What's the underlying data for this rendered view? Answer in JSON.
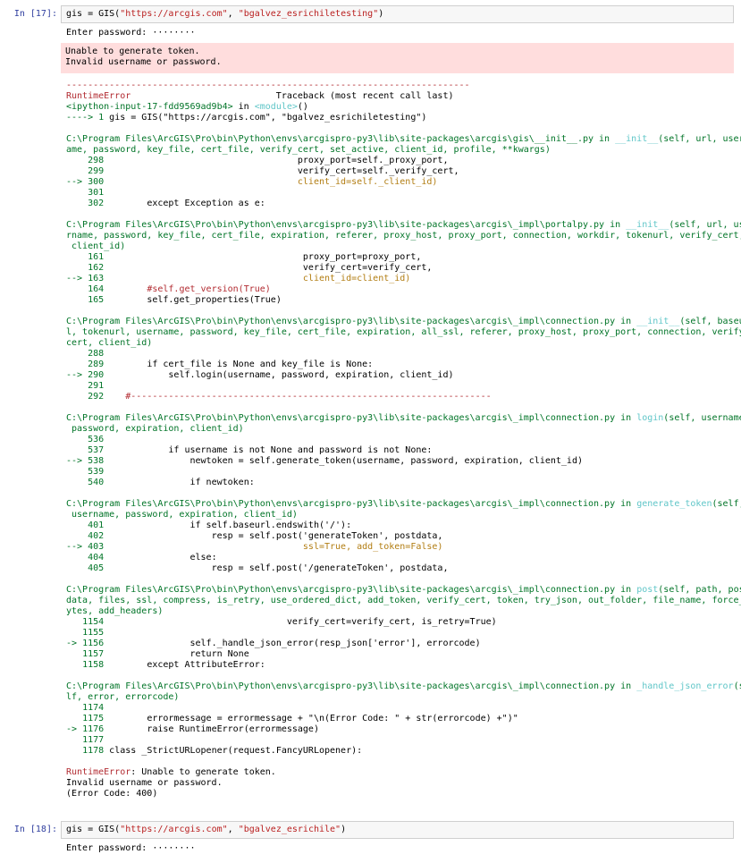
{
  "cell17": {
    "prompt": "In [17]:",
    "code_pre": "gis = GIS(",
    "code_s1": "\"https://arcgis.com\"",
    "code_mid": ", ",
    "code_s2": "\"bgalvez_esrichiletesting\"",
    "code_post": ")",
    "password_prompt": "Enter password: ········",
    "stderr": "Unable to generate token.\nInvalid username or password."
  },
  "traceback": {
    "dashes": "---------------------------------------------------------------------------",
    "err_name": "RuntimeError",
    "tb_header": "                           Traceback (most recent call last)",
    "input_ref": "<ipython-input-17-fdd9569ad9b4>",
    "in_word": " in ",
    "module": "<module>",
    "module_paren": "()",
    "line1_arrow": "----> 1 ",
    "line1_code": "gis = GIS(\"https://arcgis.com\", \"bgalvez_esrichiletesting\")",
    "frames": [
      {
        "path_lines": [
          "C:\\Program Files\\ArcGIS\\Pro\\bin\\Python\\envs\\arcgispro-py3\\lib\\site-packages\\arcgis\\gis\\__init__.py in ",
          "ame, password, key_file, cert_file, verify_cert, set_active, client_id, profile, **kwargs)"
        ],
        "func": "__init__",
        "func_rest": "(self, url, usern",
        "lines": [
          {
            "arrow": "    ",
            "num": "298",
            "code": "                                    proxy_port=self._proxy_port,",
            "hl": false
          },
          {
            "arrow": "    ",
            "num": "299",
            "code": "                                    verify_cert=self._verify_cert,",
            "hl": false
          },
          {
            "arrow": "--> ",
            "num": "300",
            "code": "                                    client_id=self._client_id)",
            "hl": true
          },
          {
            "arrow": "    ",
            "num": "301",
            "code": "",
            "hl": false
          },
          {
            "arrow": "    ",
            "num": "302",
            "code": "        except Exception as e:",
            "hl": false
          }
        ]
      },
      {
        "path_lines": [
          "C:\\Program Files\\ArcGIS\\Pro\\bin\\Python\\envs\\arcgispro-py3\\lib\\site-packages\\arcgis\\_impl\\portalpy.py in ",
          "rname, password, key_file, cert_file, expiration, referer, proxy_host, proxy_port, connection, workdir, tokenurl, verify_cert,",
          " client_id)"
        ],
        "func": "__init__",
        "func_rest": "(self, url, use",
        "lines": [
          {
            "arrow": "    ",
            "num": "161",
            "code": "                                     proxy_port=proxy_port,",
            "hl": false
          },
          {
            "arrow": "    ",
            "num": "162",
            "code": "                                     verify_cert=verify_cert,",
            "hl": false
          },
          {
            "arrow": "--> ",
            "num": "163",
            "code": "                                     client_id=client_id)",
            "hl": true
          },
          {
            "arrow": "    ",
            "num": "164",
            "code": "        #self.get_version(True)",
            "hl": false,
            "comment": true
          },
          {
            "arrow": "    ",
            "num": "165",
            "code": "        self.get_properties(True)",
            "hl": false
          }
        ]
      },
      {
        "path_lines": [
          "C:\\Program Files\\ArcGIS\\Pro\\bin\\Python\\envs\\arcgispro-py3\\lib\\site-packages\\arcgis\\_impl\\connection.py in ",
          "l, tokenurl, username, password, key_file, cert_file, expiration, all_ssl, referer, proxy_host, proxy_port, connection, verify_",
          "cert, client_id)"
        ],
        "func": "__init__",
        "func_rest": "(self, baseur",
        "lines": [
          {
            "arrow": "    ",
            "num": "288",
            "code": "",
            "hl": false
          },
          {
            "arrow": "    ",
            "num": "289",
            "code": "        if cert_file is None and key_file is None:",
            "hl": false
          },
          {
            "arrow": "--> ",
            "num": "290",
            "code": "            self.login(username, password, expiration, client_id)",
            "hl": false
          },
          {
            "arrow": "    ",
            "num": "291",
            "code": "",
            "hl": false
          },
          {
            "arrow": "    ",
            "num": "292",
            "code": "    #-------------------------------------------------------------------",
            "hl": false,
            "comment": true
          }
        ]
      },
      {
        "path_lines": [
          "C:\\Program Files\\ArcGIS\\Pro\\bin\\Python\\envs\\arcgispro-py3\\lib\\site-packages\\arcgis\\_impl\\connection.py in ",
          " password, expiration, client_id)"
        ],
        "func": "login",
        "func_rest": "(self, username,",
        "lines": [
          {
            "arrow": "    ",
            "num": "536",
            "code": "",
            "hl": false
          },
          {
            "arrow": "    ",
            "num": "537",
            "code": "            if username is not None and password is not None:",
            "hl": false
          },
          {
            "arrow": "--> ",
            "num": "538",
            "code": "                newtoken = self.generate_token(username, password, expiration, client_id)",
            "hl": false
          },
          {
            "arrow": "    ",
            "num": "539",
            "code": "",
            "hl": false
          },
          {
            "arrow": "    ",
            "num": "540",
            "code": "                if newtoken:",
            "hl": false
          }
        ]
      },
      {
        "path_lines": [
          "C:\\Program Files\\ArcGIS\\Pro\\bin\\Python\\envs\\arcgispro-py3\\lib\\site-packages\\arcgis\\_impl\\connection.py in ",
          " username, password, expiration, client_id)"
        ],
        "func": "generate_token",
        "func_rest": "(self,",
        "lines": [
          {
            "arrow": "    ",
            "num": "401",
            "code": "                if self.baseurl.endswith('/'):",
            "hl": false
          },
          {
            "arrow": "    ",
            "num": "402",
            "code": "                    resp = self.post('generateToken', postdata,",
            "hl": false
          },
          {
            "arrow": "--> ",
            "num": "403",
            "code": "                                     ssl=True, add_token=False)",
            "hl": true
          },
          {
            "arrow": "    ",
            "num": "404",
            "code": "                else:",
            "hl": false
          },
          {
            "arrow": "    ",
            "num": "405",
            "code": "                    resp = self.post('/generateToken', postdata,",
            "hl": false
          }
        ]
      },
      {
        "path_lines": [
          "C:\\Program Files\\ArcGIS\\Pro\\bin\\Python\\envs\\arcgispro-py3\\lib\\site-packages\\arcgis\\_impl\\connection.py in ",
          "data, files, ssl, compress, is_retry, use_ordered_dict, add_token, verify_cert, token, try_json, out_folder, file_name, force_b",
          "ytes, add_headers)"
        ],
        "func": "post",
        "func_rest": "(self, path, post",
        "lines": [
          {
            "arrow": "   ",
            "num": "1154",
            "code": "                                  verify_cert=verify_cert, is_retry=True)",
            "hl": false
          },
          {
            "arrow": "   ",
            "num": "1155",
            "code": "",
            "hl": false
          },
          {
            "arrow": "-> ",
            "num": "1156",
            "code": "                self._handle_json_error(resp_json['error'], errorcode)",
            "hl": false
          },
          {
            "arrow": "   ",
            "num": "1157",
            "code": "                return None",
            "hl": false
          },
          {
            "arrow": "   ",
            "num": "1158",
            "code": "        except AttributeError:",
            "hl": false
          }
        ]
      },
      {
        "path_lines": [
          "C:\\Program Files\\ArcGIS\\Pro\\bin\\Python\\envs\\arcgispro-py3\\lib\\site-packages\\arcgis\\_impl\\connection.py in ",
          "lf, error, errorcode)"
        ],
        "func": "_handle_json_error",
        "func_rest": "(se",
        "lines": [
          {
            "arrow": "   ",
            "num": "1174",
            "code": "",
            "hl": false
          },
          {
            "arrow": "   ",
            "num": "1175",
            "code": "        errormessage = errormessage + \"\\n(Error Code: \" + str(errorcode) +\")\"",
            "hl": false
          },
          {
            "arrow": "-> ",
            "num": "1176",
            "code": "        raise RuntimeError(errormessage)",
            "hl": false
          },
          {
            "arrow": "   ",
            "num": "1177",
            "code": "",
            "hl": false
          },
          {
            "arrow": "   ",
            "num": "1178",
            "code": " class _StrictURLopener(request.FancyURLopener):",
            "hl": false
          }
        ]
      }
    ],
    "final_name": "RuntimeError",
    "final_msg": ": Unable to generate token.\nInvalid username or password.\n(Error Code: 400)"
  },
  "cell18": {
    "prompt": "In [18]:",
    "code_pre": "gis = GIS(",
    "code_s1": "\"https://arcgis.com\"",
    "code_mid": ", ",
    "code_s2": "\"bgalvez_esrichile\"",
    "code_post": ")",
    "password_prompt": "Enter password: ········"
  },
  "colors": {
    "error_bg": "#ffdddd",
    "prompt": "#303f9f",
    "string": "#ba2121",
    "red": "#b22b31",
    "green": "#007427",
    "cyan": "#60c6c8",
    "yellow": "#b27d12"
  }
}
